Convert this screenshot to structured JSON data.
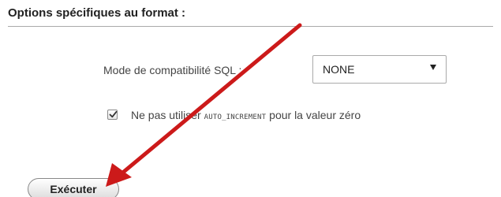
{
  "section": {
    "title": "Options spécifiques au format :"
  },
  "sql_mode": {
    "label": "Mode de compatibilité SQL :",
    "selected": "NONE"
  },
  "auto_increment_option": {
    "checked": true,
    "label_before": "Ne pas utiliser ",
    "label_code": "AUTO_INCREMENT",
    "label_after": " pour la valeur zéro"
  },
  "actions": {
    "execute_label": "Exécuter"
  },
  "annotation": {
    "arrow_color": "#cc1a1a"
  },
  "icons": {
    "select_arrow": "chevron-down-icon",
    "checkbox_mark": "checkmark-icon",
    "annotation": "red-arrow-icon"
  }
}
